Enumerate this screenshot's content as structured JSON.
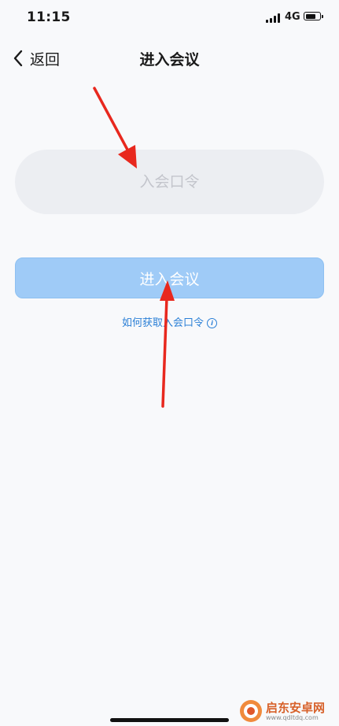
{
  "status_bar": {
    "time": "11:15",
    "network": "4G",
    "signal_bars": 4,
    "battery_level": 0.8,
    "icons": [
      "signal-icon",
      "battery-icon"
    ]
  },
  "nav": {
    "back_label": "返回",
    "back_icon": "chevron-left-icon",
    "title": "进入会议"
  },
  "form": {
    "code_placeholder": "入会口令",
    "code_value": "",
    "join_button_label": "进入会议",
    "help_link_text": "如何获取入会口令",
    "help_icon": "info-icon"
  },
  "annotations": {
    "arrows": 2,
    "arrow_color": "#e8281e"
  },
  "watermark": {
    "title": "启东安卓网",
    "url": "www.qdltdq.com"
  },
  "colors": {
    "background": "#f8f9fb",
    "input_background": "#eceef2",
    "button_background": "#9fcbf7",
    "link": "#2a7fd6",
    "watermark": "#d7612a"
  }
}
